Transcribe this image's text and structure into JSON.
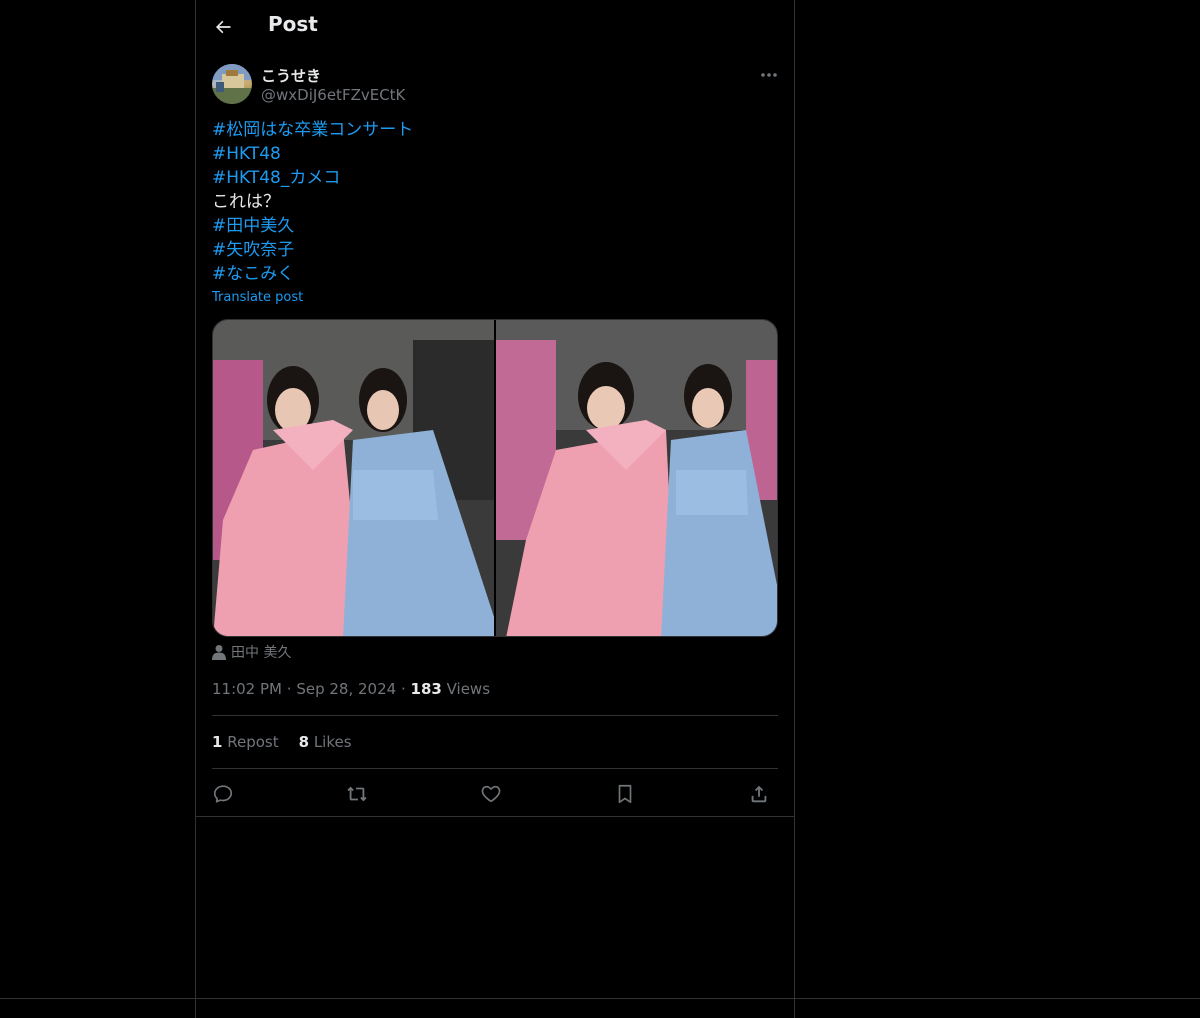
{
  "header": {
    "title": "Post"
  },
  "author": {
    "display_name": "こうせき",
    "handle": "@wxDiJ6etFZvECtK"
  },
  "post": {
    "lines": [
      {
        "text": "#松岡はな卒業コンサート",
        "type": "hashtag"
      },
      {
        "text": "#HKT48",
        "type": "hashtag"
      },
      {
        "text": "#HKT48_カメコ",
        "type": "hashtag"
      },
      {
        "text": "これは？",
        "type": "plain"
      },
      {
        "text": "#田中美久",
        "type": "hashtag"
      },
      {
        "text": "#矢吹奈子",
        "type": "hashtag"
      },
      {
        "text": "#なこみく",
        "type": "hashtag"
      }
    ],
    "translate_label": "Translate post",
    "tagged_person": "田中 美久",
    "time": "11:02 PM",
    "date": "Sep 28, 2024",
    "views_count": "183",
    "views_label": "Views",
    "dot": "·"
  },
  "stats": {
    "reposts_count": "1",
    "reposts_label": "Repost",
    "likes_count": "8",
    "likes_label": "Likes"
  },
  "colors": {
    "background": "#000000",
    "text": "#e7e9ea",
    "muted": "#71767b",
    "accent": "#1d9bf0",
    "border": "#2f3336"
  },
  "icons": {
    "back": "arrow-left-icon",
    "more": "more-horizontal-icon",
    "reply": "reply-icon",
    "repost": "repost-icon",
    "like": "heart-icon",
    "bookmark": "bookmark-icon",
    "share": "share-icon",
    "person": "person-icon"
  }
}
